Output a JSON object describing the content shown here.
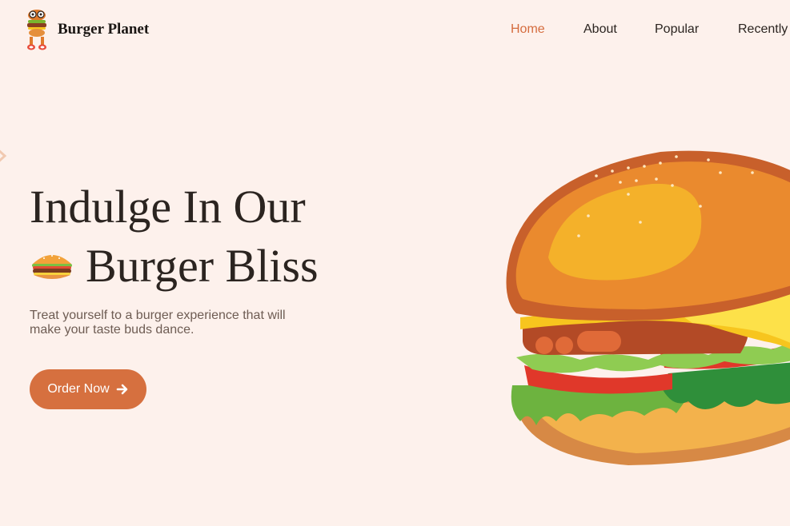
{
  "header": {
    "brand": "Burger Planet",
    "nav": [
      {
        "label": "Home",
        "active": true
      },
      {
        "label": "About",
        "active": false
      },
      {
        "label": "Popular",
        "active": false
      },
      {
        "label": "Recently",
        "active": false
      }
    ]
  },
  "hero": {
    "title_line1": "Indulge In Our",
    "title_line2": "Burger Bliss",
    "subtitle": "Treat yourself to a burger experience that will make your taste buds dance.",
    "cta_label": "Order Now"
  },
  "icons": {
    "logo": "burger-mascot-icon",
    "inline": "burger-icon",
    "cta": "arrow-right-icon",
    "hero_image": "burger-illustration"
  },
  "colors": {
    "background": "#fdf1ec",
    "accent": "#d6703f",
    "nav_active": "#d56c3e",
    "text": "#2b2420"
  }
}
